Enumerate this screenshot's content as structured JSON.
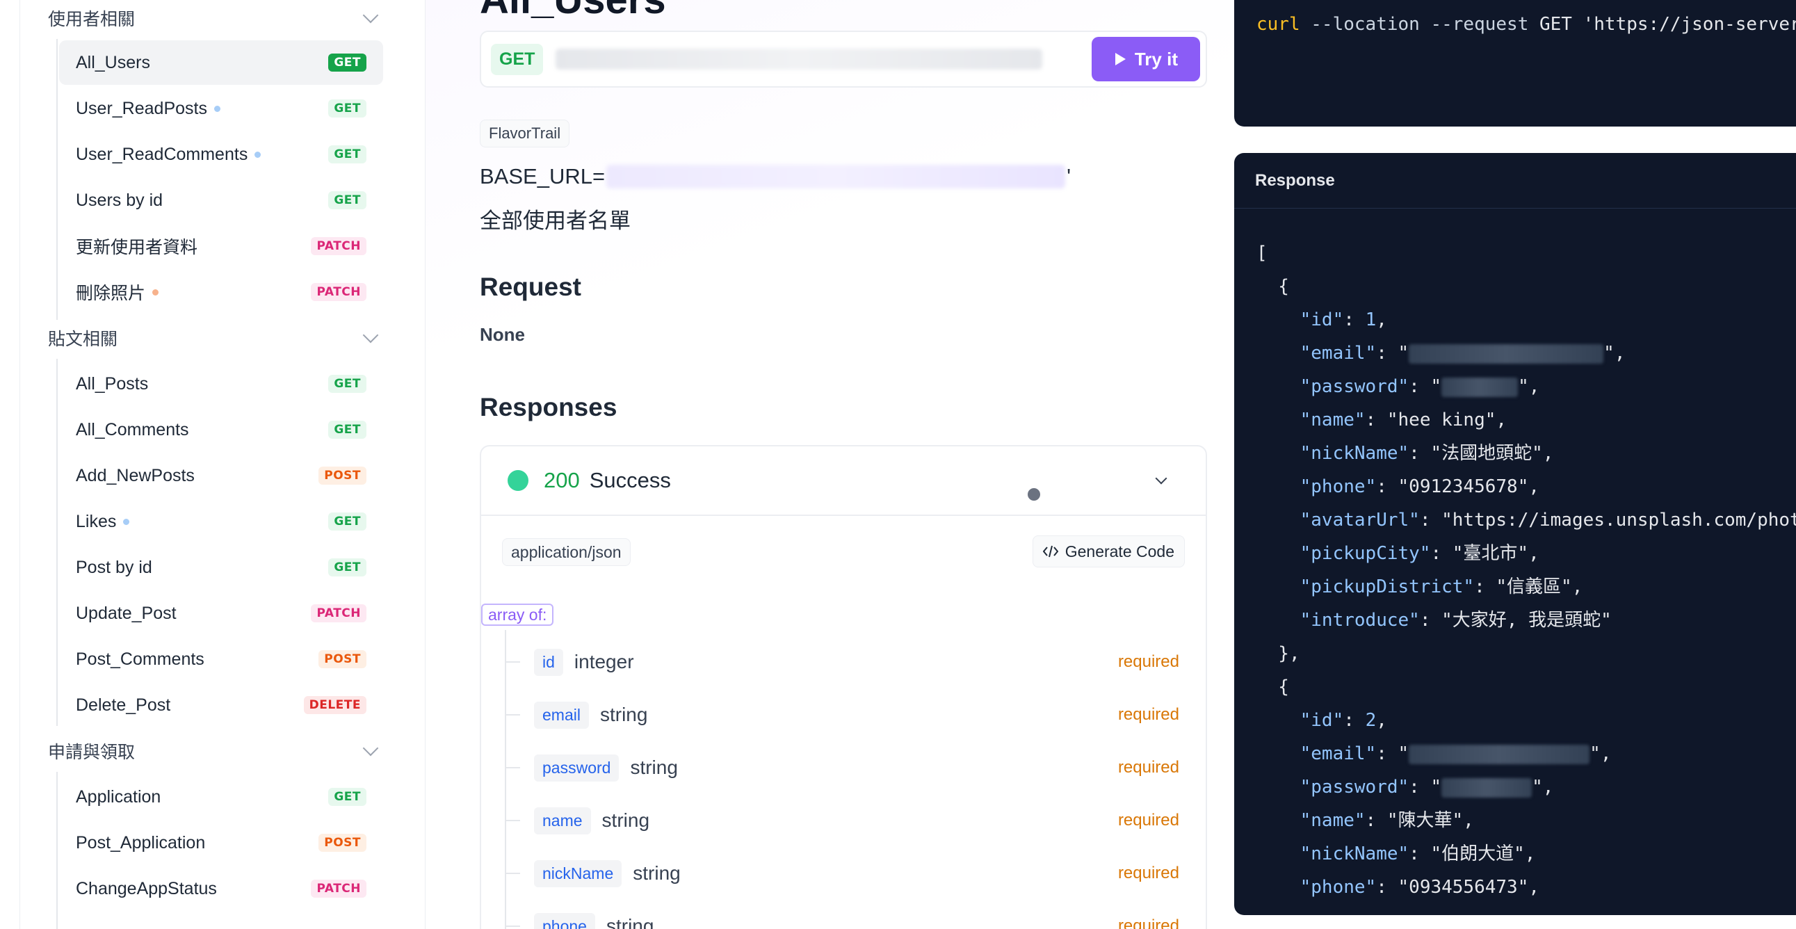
{
  "sidebar": {
    "groups": [
      {
        "label": "使用者相關",
        "items": [
          {
            "label": "All_Users",
            "method": "GET",
            "active": true
          },
          {
            "label": "User_ReadPosts",
            "method": "GET",
            "dot": "blue"
          },
          {
            "label": "User_ReadComments",
            "method": "GET",
            "dot": "blue"
          },
          {
            "label": "Users by id",
            "method": "GET"
          },
          {
            "label": "更新使用者資料",
            "method": "PATCH"
          },
          {
            "label": "刪除照片",
            "method": "PATCH",
            "dot": "orange"
          }
        ]
      },
      {
        "label": "貼文相關",
        "items": [
          {
            "label": "All_Posts",
            "method": "GET"
          },
          {
            "label": "All_Comments",
            "method": "GET"
          },
          {
            "label": "Add_NewPosts",
            "method": "POST"
          },
          {
            "label": "Likes",
            "method": "GET",
            "dot": "blue"
          },
          {
            "label": "Post by id",
            "method": "GET"
          },
          {
            "label": "Update_Post",
            "method": "PATCH"
          },
          {
            "label": "Post_Comments",
            "method": "POST"
          },
          {
            "label": "Delete_Post",
            "method": "DELETE"
          }
        ]
      },
      {
        "label": "申請與領取",
        "items": [
          {
            "label": "Application",
            "method": "GET"
          },
          {
            "label": "Post_Application",
            "method": "POST"
          },
          {
            "label": "ChangeAppStatus",
            "method": "PATCH"
          }
        ]
      }
    ]
  },
  "main": {
    "title": "All_Users",
    "request_method": "GET",
    "try_label": "Try it",
    "tag": "FlavorTrail",
    "base_url_prefix": "BASE_URL=",
    "base_url_suffix": "'",
    "description": "全部使用者名單",
    "request_heading": "Request",
    "request_body": "None",
    "responses_heading": "Responses",
    "response": {
      "code": "200",
      "text": "Success",
      "content_type": "application/json",
      "generate_label": "Generate Code",
      "array_of": "array of:",
      "fields": [
        {
          "name": "id",
          "type": "integer",
          "req": "required"
        },
        {
          "name": "email",
          "type": "string",
          "req": "required"
        },
        {
          "name": "password",
          "type": "string",
          "req": "required"
        },
        {
          "name": "name",
          "type": "string",
          "req": "required"
        },
        {
          "name": "nickName",
          "type": "string",
          "req": "required"
        },
        {
          "name": "phone",
          "type": "string",
          "req": "required"
        }
      ]
    }
  },
  "code": {
    "curl_cmd": "curl",
    "curl_rest": " --location --request ",
    "curl_method": "GET",
    "curl_url": " 'https://json-server-",
    "response_title": "Response",
    "lines": [
      {
        "t": "["
      },
      {
        "t": "  {"
      },
      {
        "t": "    \"id\": ",
        "k": "id",
        "num": "1",
        "end": ","
      },
      {
        "t": "email",
        "k": "email",
        "blur": 280
      },
      {
        "t": "password",
        "k": "password",
        "blur": 110
      },
      {
        "k": "name",
        "val": "\"hee king\","
      },
      {
        "k": "nickName",
        "val": "\"法國地頭蛇\","
      },
      {
        "k": "phone",
        "val": "\"0912345678\","
      },
      {
        "k": "avatarUrl",
        "val": "\"https://images.unsplash.com/photo"
      },
      {
        "k": "pickupCity",
        "val": "\"臺北市\","
      },
      {
        "k": "pickupDistrict",
        "val": "\"信義區\","
      },
      {
        "k": "introduce",
        "val": "\"大家好, 我是頭蛇\""
      },
      {
        "t": "  },"
      },
      {
        "t": "  {"
      },
      {
        "k": "id",
        "num": "2",
        "end": ","
      },
      {
        "k": "email",
        "blur": 260
      },
      {
        "k": "password",
        "blur": 130
      },
      {
        "k": "name",
        "val": "\"陳大華\","
      },
      {
        "k": "nickName",
        "val": "\"伯朗大道\","
      },
      {
        "k": "phone",
        "val": "\"0934556473\","
      }
    ]
  },
  "colors": {
    "accent": "#8b5cf6",
    "get": "#16a34a",
    "patch": "#db2777",
    "post": "#ea580c",
    "delete": "#dc2626",
    "code_bg": "#0f1729"
  }
}
